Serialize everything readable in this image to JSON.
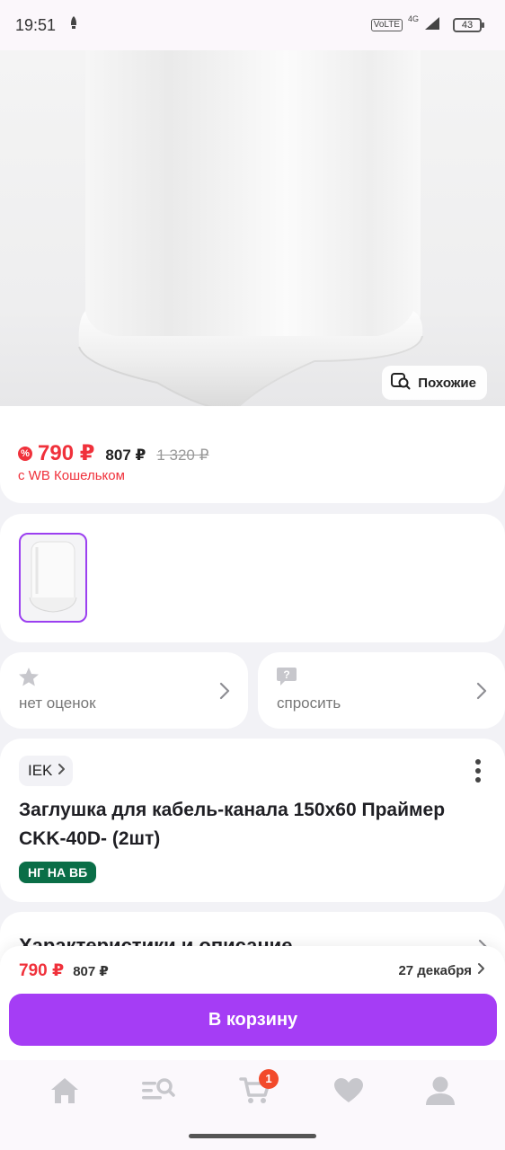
{
  "status_bar": {
    "time": "19:51",
    "network_label": "VoLTE",
    "network_type": "4G",
    "battery": "43"
  },
  "hero": {
    "similar_label": "Похожие"
  },
  "price": {
    "current": "790 ₽",
    "old": "807 ₽",
    "crossed": "1 320 ₽",
    "wallet_note": "с WB Кошельком",
    "accent_color": "#f0313b"
  },
  "rating": {
    "label": "нет оценок"
  },
  "ask": {
    "label": "спросить"
  },
  "product": {
    "brand": "IEK",
    "title": "Заглушка для кабель-канала 150x60 Праймер CKK-40D- (2шт)",
    "promo_badge": "НГ НА ВБ"
  },
  "specs": {
    "title": "Характеристики и описание"
  },
  "buy_bar": {
    "price": "790 ₽",
    "old_price": "807 ₽",
    "delivery_date": "27 декабря",
    "button_label": "В корзину",
    "button_color": "#a53df5"
  },
  "tab_bar": {
    "items": [
      {
        "icon": "home-icon"
      },
      {
        "icon": "catalog-search-icon"
      },
      {
        "icon": "cart-icon",
        "badge": "1"
      },
      {
        "icon": "heart-icon"
      },
      {
        "icon": "profile-icon"
      }
    ]
  }
}
